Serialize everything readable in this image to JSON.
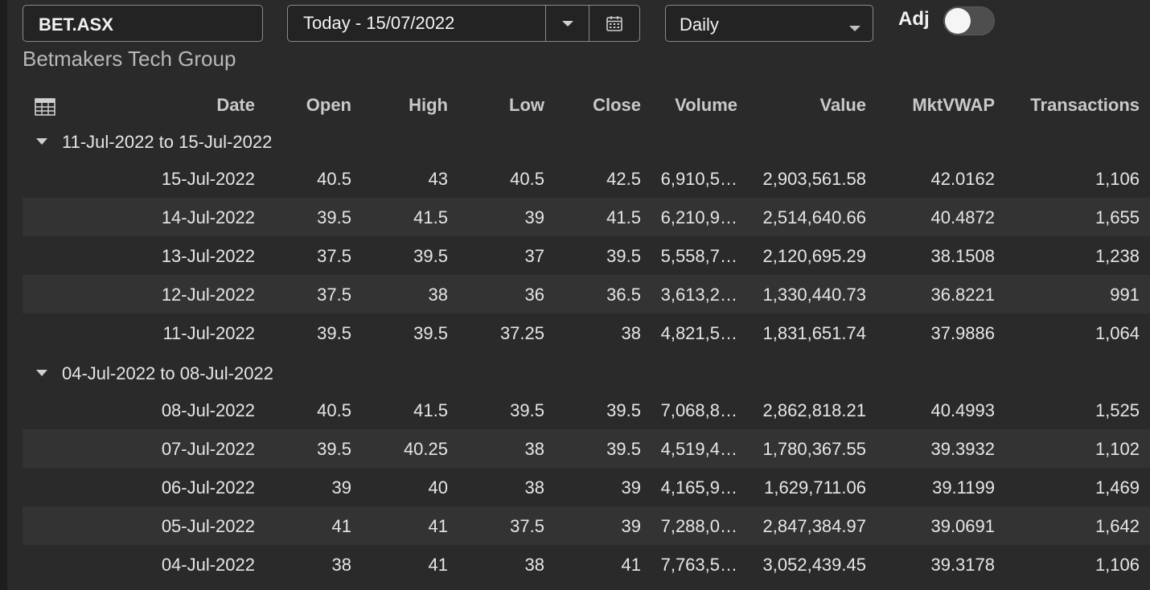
{
  "header": {
    "symbol": "BET.ASX",
    "date_range": "Today - 15/07/2022",
    "frequency": "Daily",
    "adj_label": "Adj",
    "adj_on": false,
    "company_name": "Betmakers Tech Group"
  },
  "columns": {
    "date": "Date",
    "open": "Open",
    "high": "High",
    "low": "Low",
    "close": "Close",
    "volume": "Volume",
    "value": "Value",
    "vwap": "MktVWAP",
    "transactions": "Transactions"
  },
  "groups": [
    {
      "label": "11-Jul-2022 to 15-Jul-2022",
      "rows": [
        {
          "date": "15-Jul-2022",
          "open": "40.5",
          "high": "43",
          "low": "40.5",
          "close": "42.5",
          "volume": "6,910,5…",
          "value": "2,903,561.58",
          "vwap": "42.0162",
          "tx": "1,106"
        },
        {
          "date": "14-Jul-2022",
          "open": "39.5",
          "high": "41.5",
          "low": "39",
          "close": "41.5",
          "volume": "6,210,9…",
          "value": "2,514,640.66",
          "vwap": "40.4872",
          "tx": "1,655"
        },
        {
          "date": "13-Jul-2022",
          "open": "37.5",
          "high": "39.5",
          "low": "37",
          "close": "39.5",
          "volume": "5,558,7…",
          "value": "2,120,695.29",
          "vwap": "38.1508",
          "tx": "1,238"
        },
        {
          "date": "12-Jul-2022",
          "open": "37.5",
          "high": "38",
          "low": "36",
          "close": "36.5",
          "volume": "3,613,2…",
          "value": "1,330,440.73",
          "vwap": "36.8221",
          "tx": "991"
        },
        {
          "date": "11-Jul-2022",
          "open": "39.5",
          "high": "39.5",
          "low": "37.25",
          "close": "38",
          "volume": "4,821,5…",
          "value": "1,831,651.74",
          "vwap": "37.9886",
          "tx": "1,064"
        }
      ]
    },
    {
      "label": "04-Jul-2022 to 08-Jul-2022",
      "rows": [
        {
          "date": "08-Jul-2022",
          "open": "40.5",
          "high": "41.5",
          "low": "39.5",
          "close": "39.5",
          "volume": "7,068,8…",
          "value": "2,862,818.21",
          "vwap": "40.4993",
          "tx": "1,525"
        },
        {
          "date": "07-Jul-2022",
          "open": "39.5",
          "high": "40.25",
          "low": "38",
          "close": "39.5",
          "volume": "4,519,4…",
          "value": "1,780,367.55",
          "vwap": "39.3932",
          "tx": "1,102"
        },
        {
          "date": "06-Jul-2022",
          "open": "39",
          "high": "40",
          "low": "38",
          "close": "39",
          "volume": "4,165,9…",
          "value": "1,629,711.06",
          "vwap": "39.1199",
          "tx": "1,469"
        },
        {
          "date": "05-Jul-2022",
          "open": "41",
          "high": "41",
          "low": "37.5",
          "close": "39",
          "volume": "7,288,0…",
          "value": "2,847,384.97",
          "vwap": "39.0691",
          "tx": "1,642"
        },
        {
          "date": "04-Jul-2022",
          "open": "38",
          "high": "41",
          "low": "38",
          "close": "41",
          "volume": "7,763,5…",
          "value": "3,052,439.45",
          "vwap": "39.3178",
          "tx": "1,106"
        }
      ]
    }
  ],
  "icons": {
    "grid": "table-grid-icon",
    "calendar": "calendar-icon",
    "dropdown": "chevron-down-icon",
    "group_toggle": "caret-down-icon"
  },
  "colors": {
    "background": "#2a2a2a",
    "alt_row": "#333333",
    "border": "#8a8a8a",
    "text": "#e6e6e6"
  }
}
